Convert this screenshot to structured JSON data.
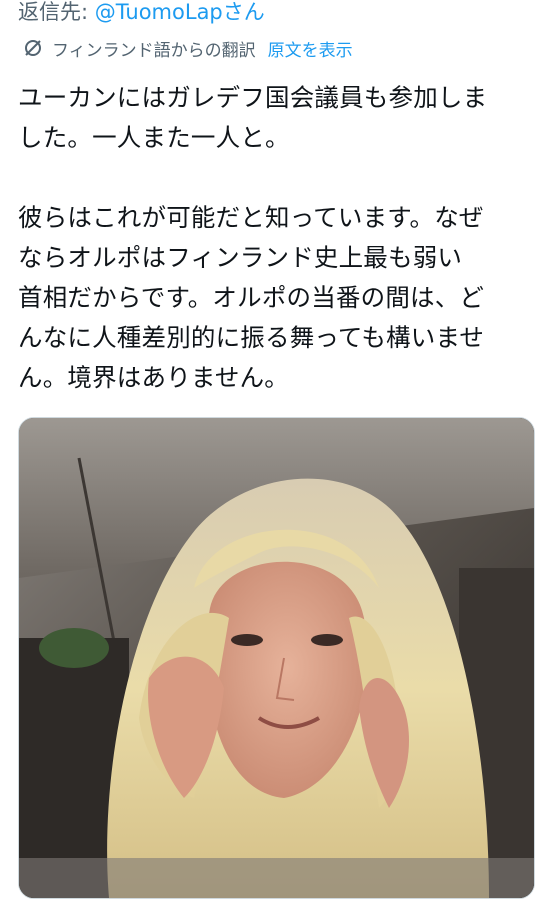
{
  "reply": {
    "prefix": "返信先: ",
    "handle": "@TuomoLapさん"
  },
  "translation": {
    "icon": "translate-globe-icon",
    "label": "フィンランド語からの翻訳",
    "show_original": "原文を表示"
  },
  "tweet": {
    "lines": [
      "ユーカンにはガレデフ国会議員も参加しま",
      "した。一人また一人と。",
      "",
      "彼らはこれが可能だと知っています。なぜ",
      "ならオルポはフィンランド史上最も弱い",
      "首相だからです。オルポの当番の間は、ど",
      "んなに人種差別的に振る舞っても構いませ",
      "ん。境界はありません。"
    ]
  },
  "media": {
    "type": "photo",
    "colors": {
      "hair": "#e6d7a8",
      "skin": "#d9a088",
      "background": "#4a4540"
    }
  }
}
